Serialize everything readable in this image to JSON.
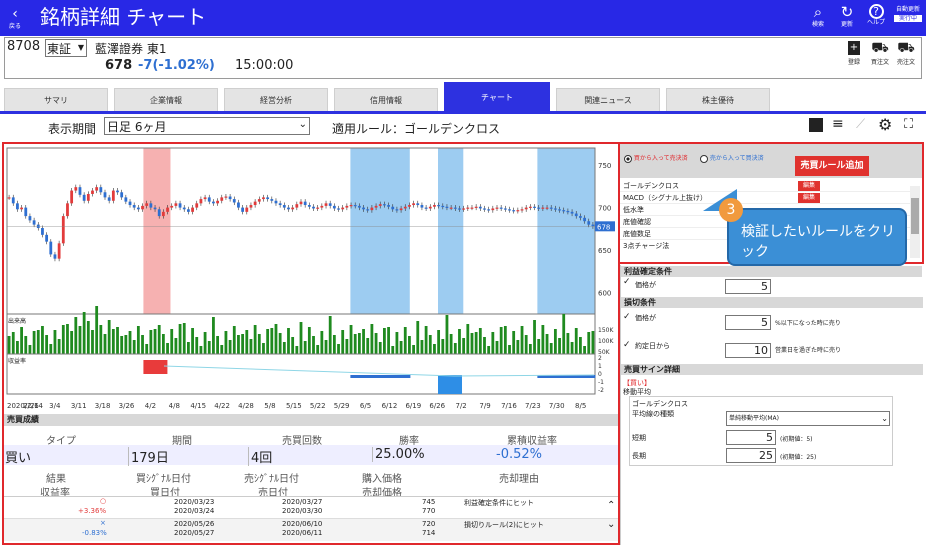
{
  "header": {
    "back_label": "戻る",
    "title": "銘柄詳細 チャート",
    "icons": [
      {
        "name": "search-icon",
        "glyph": "🔍",
        "label": "検索"
      },
      {
        "name": "refresh-icon",
        "glyph": "↻",
        "label": "更新"
      },
      {
        "name": "help-icon",
        "glyph": "?",
        "label": "ヘルプ"
      }
    ],
    "auto_update_label": "自動更新",
    "auto_update_status": "実行中"
  },
  "stock": {
    "code": "8708",
    "market": "東証",
    "name": "藍澤證券 東1",
    "price": "678",
    "change": "-7(-1.02%)",
    "time": "15:00:00",
    "actions": [
      "登録",
      "買注文",
      "売注文"
    ]
  },
  "tabs": [
    "サマリ",
    "企業情報",
    "経営分析",
    "信用情報",
    "チャート",
    "関連ニュース",
    "株主優待"
  ],
  "toolbar": {
    "period_label": "表示期間",
    "period_value": "日足 6ヶ月",
    "rule_text": "適用ルール：ゴールデンクロス"
  },
  "chart_data": {
    "type": "candlestick",
    "price_ticks": [
      "750",
      "700",
      "678",
      "650",
      "600"
    ],
    "ylim": [
      575,
      770
    ],
    "last_price": 678,
    "x_labels": [
      "2020/2/14",
      "2/26",
      "3/4",
      "3/11",
      "3/18",
      "3/26",
      "4/2",
      "4/8",
      "4/15",
      "4/22",
      "4/28",
      "5/8",
      "5/15",
      "5/22",
      "5/29",
      "6/5",
      "6/12",
      "6/19",
      "6/26",
      "7/2",
      "7/9",
      "7/16",
      "7/23",
      "7/30",
      "8/5"
    ],
    "volume_label": "出来高",
    "volume_ticks": [
      "150K",
      "100K",
      "50K"
    ],
    "profit_label": "収益率",
    "profit_ticks": [
      "2",
      "1",
      "0",
      "-1",
      "-2"
    ],
    "closes": [
      712,
      705,
      698,
      700,
      690,
      685,
      680,
      676,
      668,
      660,
      645,
      640,
      658,
      690,
      705,
      720,
      724,
      715,
      708,
      716,
      720,
      724,
      718,
      712,
      708,
      720,
      718,
      712,
      707,
      703,
      700,
      698,
      702,
      705,
      700,
      698,
      690,
      695,
      700,
      702,
      705,
      700,
      698,
      695,
      700,
      705,
      710,
      712,
      707,
      705,
      708,
      712,
      713,
      710,
      706,
      700,
      695,
      700,
      703,
      707,
      710,
      712,
      710,
      708,
      705,
      703,
      700,
      698,
      700,
      704,
      707,
      703,
      701,
      699,
      700,
      702,
      705,
      702,
      699,
      698,
      700,
      702,
      703,
      702,
      700,
      698,
      697,
      700,
      702,
      704,
      703,
      701,
      698,
      697,
      699,
      701,
      703,
      705,
      703,
      700,
      699,
      701,
      703,
      702,
      701,
      700,
      700,
      699,
      698,
      699,
      700,
      700,
      701,
      699,
      698,
      697,
      699,
      700,
      699,
      698,
      697,
      696,
      697,
      698,
      700,
      701,
      700,
      699,
      700,
      700,
      699,
      698,
      697,
      696,
      695,
      693,
      690,
      688,
      684,
      680,
      678
    ]
  },
  "results": {
    "title": "売買成績",
    "headers": [
      "タイプ",
      "期間",
      "売買回数",
      "勝率",
      "累積収益率"
    ],
    "values": [
      "買い",
      "179日",
      "4回",
      "25.00%",
      "-0.52%"
    ],
    "sub_headers_1": [
      "結果",
      "買ｼｸﾞﾅﾙ日付",
      "売ｼｸﾞﾅﾙ日付",
      "購入価格",
      "売却理由"
    ],
    "sub_headers_2": [
      "収益率",
      "買日付",
      "売日付",
      "売却価格"
    ],
    "rows": [
      {
        "mark": "○",
        "pct": "+3.36%",
        "buy_sig": "2020/03/23",
        "buy": "2020/03/24",
        "sell_sig": "2020/03/27",
        "sell": "2020/03/30",
        "bprice": "745",
        "sprice": "770",
        "reason": "利益確定条件にヒット"
      },
      {
        "mark": "×",
        "pct": "-0.83%",
        "buy_sig": "2020/05/26",
        "buy": "2020/05/27",
        "sell_sig": "2020/06/10",
        "sell": "2020/06/11",
        "bprice": "720",
        "sprice": "714",
        "reason": "損切りルール(2)にヒット"
      }
    ]
  },
  "rules": {
    "radio_buy": "買から入って売決済",
    "radio_sell": "売から入って買決済",
    "add_button": "売買ルール追加",
    "items": [
      "ゴールデンクロス",
      "MACD（シグナル上抜け）",
      "低水準",
      "底値確認",
      "底値数足",
      "3点チャージ法"
    ],
    "edit_label": "編集",
    "tooltip_num": "3",
    "tooltip_text": "検証したいルールをクリック"
  },
  "conditions": {
    "take_profit": "利益確定条件",
    "tp_price_label": "価格が",
    "tp_value": "5",
    "stop_loss": "損切条件",
    "sl_price_label": "価格が",
    "sl_value": "5",
    "sl_suffix": "%以下になった時に売り",
    "sl_days_label": "約定日から",
    "sl_days_value": "10",
    "sl_days_suffix": "営業日を過ぎた時に売り",
    "signal_title": "売買サイン詳細",
    "signal_buy": "【買い】",
    "signal_method": "移動平均",
    "gc_label": "ゴールデンクロス",
    "ma_type_label": "平均線の種類",
    "ma_type_value": "単純移動平均(MA)",
    "short_label": "短期",
    "short_value": "5",
    "short_hint": "(初期値：5)",
    "long_label": "長期",
    "long_value": "25",
    "long_hint": "(初期値：25)"
  },
  "colors": {
    "accent": "#2d31e0",
    "up": "#e23b3b",
    "down": "#2e6fd1",
    "volume": "#1f8a1f",
    "highlight_red": "#f4a3a3",
    "highlight_blue": "#8cc3ef",
    "box": "#e0282c"
  }
}
